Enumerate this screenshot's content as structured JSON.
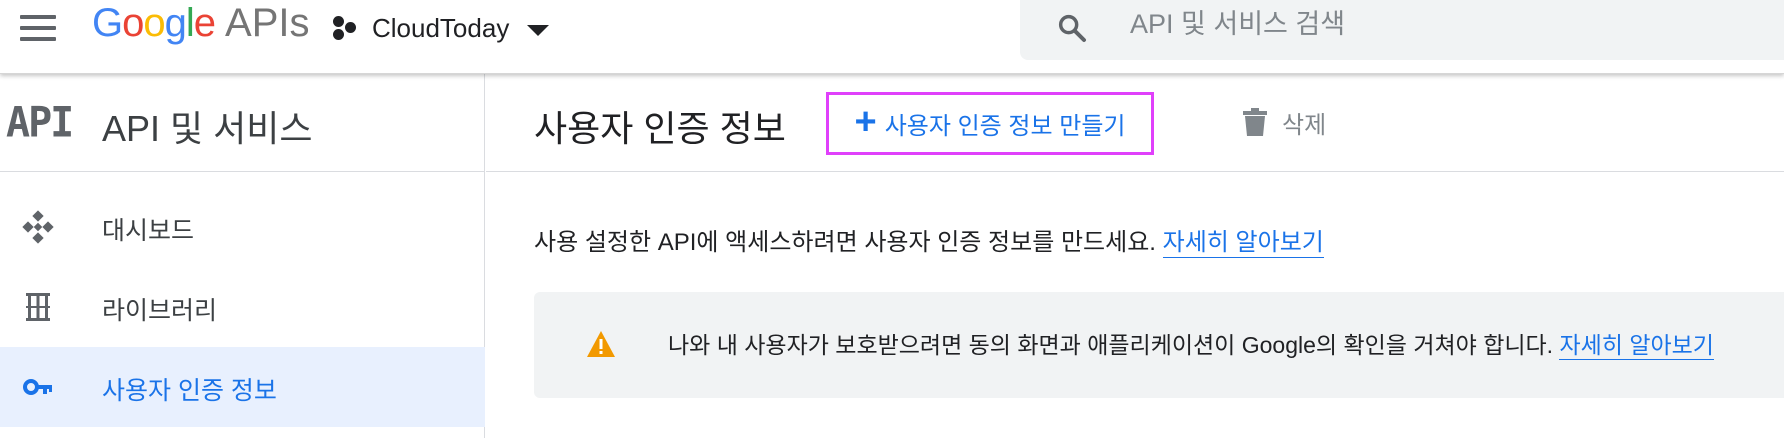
{
  "header": {
    "logo_google": "Google",
    "logo_apis": "APIs",
    "project_name": "CloudToday",
    "search_placeholder": "API 및 서비스 검색"
  },
  "sidebar": {
    "mark": "API",
    "title": "API 및 서비스",
    "items": [
      {
        "label": "대시보드",
        "icon": "dashboard-icon",
        "active": false
      },
      {
        "label": "라이브러리",
        "icon": "library-icon",
        "active": false
      },
      {
        "label": "사용자 인증 정보",
        "icon": "key-icon",
        "active": true
      }
    ]
  },
  "main": {
    "title": "사용자 인증 정보",
    "create_label": "사용자 인증 정보 만들기",
    "delete_label": "삭제",
    "info_text": "사용 설정한 API에 액세스하려면 사용자 인증 정보를 만드세요.",
    "info_link": "자세히 알아보기",
    "warning_text": "나와 내 사용자가 보호받으려면 동의 화면과 애플리케이션이 Google의 확인을 거쳐야 합니다.",
    "warning_link": "자세히 알아보기"
  },
  "colors": {
    "accent": "#1a73e8",
    "highlight_border": "#e040fb",
    "warning": "#f29900",
    "active_bg": "#e8f0fe"
  }
}
